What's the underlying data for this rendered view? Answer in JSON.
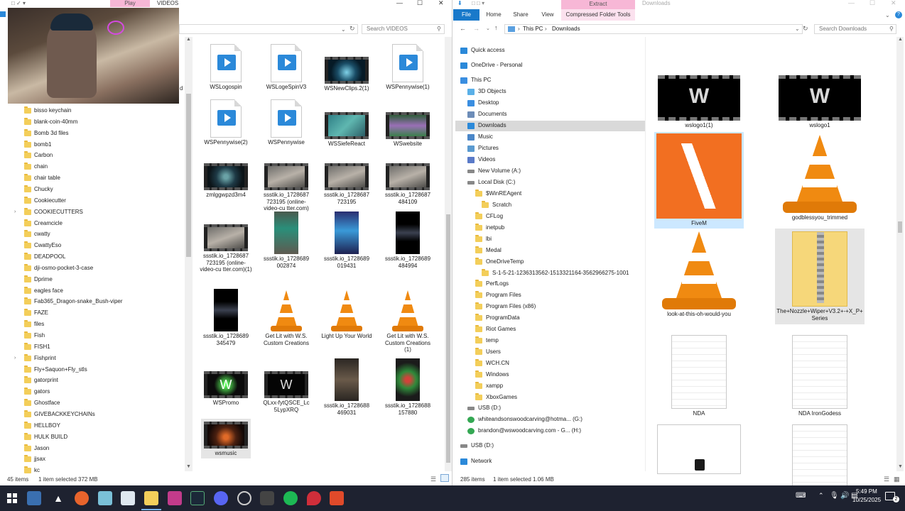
{
  "left_window": {
    "ribbon_tab": "Play",
    "title": "VIDEOS",
    "search_placeholder": "Search VIDEOS",
    "tree": [
      "bisso keychain",
      "blank-coin-40mm",
      "Bomb 3d files",
      "bomb1",
      "Carbon",
      "chain",
      "chair table",
      "Chucky",
      "Cookiecutter",
      "COOKIECUTTERS",
      "Creamcicle",
      "cwatty",
      "CwattyEso",
      "DEADPOOL",
      "dji-osmo-pocket-3-case",
      "Dprime",
      "eagles face",
      "Fab365_Dragon-snake_Bush-viper",
      "FAZE",
      "files",
      "Fish",
      "FISH1",
      "Fishprint",
      "Fly+Saquon+Fly_stls",
      "gatorprint",
      "gators",
      "Ghostface",
      "GIVEBACKKEYCHAINs",
      "HELLBOY",
      "HULK BUILD",
      "Jason",
      "jjsax",
      "kc"
    ],
    "files": [
      {
        "label": "WSLogospin",
        "kind": "video-doc"
      },
      {
        "label": "WSLogeSpinV3",
        "kind": "video-doc"
      },
      {
        "label": "WSNewClips.2(1)",
        "kind": "film-blue"
      },
      {
        "label": "WSPennywise(1)",
        "kind": "video-doc"
      },
      {
        "label": "WSPennywise(2)",
        "kind": "video-doc"
      },
      {
        "label": "WSPennywise",
        "kind": "video-doc"
      },
      {
        "label": "WSSiefeReact",
        "kind": "film-teal"
      },
      {
        "label": "WSwebsite",
        "kind": "film-green"
      },
      {
        "label": "zmlggwpzd3m4",
        "kind": "film-dark"
      },
      {
        "label": "ssstik.io_1728687 723195 (online-video-cu tter.com)",
        "kind": "film-grey"
      },
      {
        "label": "ssstik.io_1728687 723195",
        "kind": "film-grey"
      },
      {
        "label": "ssstik.io_1728687 484109",
        "kind": "film-grey"
      },
      {
        "label": "ssstik.io_1728687 723195 (online-video-cu tter.com)(1)",
        "kind": "film-grey"
      },
      {
        "label": "ssstik.io_1728689 002874",
        "kind": "portrait-green"
      },
      {
        "label": "ssstik.io_1728689 019431",
        "kind": "portrait-blue"
      },
      {
        "label": "ssstik.io_1728689 484994",
        "kind": "portrait-black"
      },
      {
        "label": "ssstik.io_1728689 345479",
        "kind": "portrait-black"
      },
      {
        "label": "Get Lit with W.S. Custom Creations",
        "kind": "cone"
      },
      {
        "label": "Light Up Your World",
        "kind": "cone"
      },
      {
        "label": "Get Lit with W.S. Custom Creations (1)",
        "kind": "cone"
      },
      {
        "label": "WSPromo",
        "kind": "film-logo"
      },
      {
        "label": "QLxx-fytQSCE_Lc 5LypXRQ",
        "kind": "film-logo-black"
      },
      {
        "label": "ssstik.io_1728688 469031",
        "kind": "portrait-brown"
      },
      {
        "label": "ssstik.io_1728688 157880",
        "kind": "portrait-green2"
      },
      {
        "label": "wsmusic",
        "kind": "film-fire"
      }
    ],
    "status_items": "45 items",
    "status_selected": "1 item selected  372 MB"
  },
  "right_window": {
    "ribbon_tab_extract": "Extract",
    "title": "Downloads",
    "tabs": [
      "File",
      "Home",
      "Share",
      "View",
      "Compressed Folder Tools"
    ],
    "breadcrumb": [
      "This PC",
      "Downloads"
    ],
    "search_placeholder": "Search Downloads",
    "nav": [
      {
        "label": "Quick access",
        "indent": 0,
        "icon": "star"
      },
      {
        "label": "OneDrive - Personal",
        "indent": 0,
        "icon": "cloud"
      },
      {
        "label": "This PC",
        "indent": 0,
        "icon": "pc"
      },
      {
        "label": "3D Objects",
        "indent": 1,
        "icon": "obj3d"
      },
      {
        "label": "Desktop",
        "indent": 1,
        "icon": "desktop"
      },
      {
        "label": "Documents",
        "indent": 1,
        "icon": "docs"
      },
      {
        "label": "Downloads",
        "indent": 1,
        "icon": "download",
        "selected": true
      },
      {
        "label": "Music",
        "indent": 1,
        "icon": "music"
      },
      {
        "label": "Pictures",
        "indent": 1,
        "icon": "pictures"
      },
      {
        "label": "Videos",
        "indent": 1,
        "icon": "videos"
      },
      {
        "label": "New Volume (A:)",
        "indent": 1,
        "icon": "drive"
      },
      {
        "label": "Local Disk (C:)",
        "indent": 1,
        "icon": "drive"
      },
      {
        "label": "$WinREAgent",
        "indent": 2,
        "icon": "folder"
      },
      {
        "label": "Scratch",
        "indent": 3,
        "icon": "folder"
      },
      {
        "label": "CFLog",
        "indent": 2,
        "icon": "folder"
      },
      {
        "label": "inetpub",
        "indent": 2,
        "icon": "folder"
      },
      {
        "label": "lbi",
        "indent": 2,
        "icon": "folder"
      },
      {
        "label": "Medal",
        "indent": 2,
        "icon": "folder"
      },
      {
        "label": "OneDriveTemp",
        "indent": 2,
        "icon": "folder"
      },
      {
        "label": "S-1-5-21-1236313562-1513321164-3562966275-1001",
        "indent": 3,
        "icon": "folder"
      },
      {
        "label": "PerfLogs",
        "indent": 2,
        "icon": "folder"
      },
      {
        "label": "Program Files",
        "indent": 2,
        "icon": "folder"
      },
      {
        "label": "Program Files (x86)",
        "indent": 2,
        "icon": "folder"
      },
      {
        "label": "ProgramData",
        "indent": 2,
        "icon": "folder"
      },
      {
        "label": "Riot Games",
        "indent": 2,
        "icon": "folder"
      },
      {
        "label": "temp",
        "indent": 2,
        "icon": "folder"
      },
      {
        "label": "Users",
        "indent": 2,
        "icon": "folder"
      },
      {
        "label": "WCH.CN",
        "indent": 2,
        "icon": "folder"
      },
      {
        "label": "Windows",
        "indent": 2,
        "icon": "folder"
      },
      {
        "label": "xampp",
        "indent": 2,
        "icon": "folder"
      },
      {
        "label": "XboxGames",
        "indent": 2,
        "icon": "folder"
      },
      {
        "label": "USB (D:)",
        "indent": 1,
        "icon": "drive"
      },
      {
        "label": "whiteandsonswoodcarving@hotma... (G:)",
        "indent": 1,
        "icon": "gdrive"
      },
      {
        "label": "brandon@wswoodcarving.com - G... (H:)",
        "indent": 1,
        "icon": "gdrive"
      },
      {
        "label": "USB (D:)",
        "indent": 0,
        "icon": "drive"
      },
      {
        "label": "Network",
        "indent": 0,
        "icon": "network"
      }
    ],
    "files": [
      {
        "label": "wslogo1(1)",
        "kind": "logo-film"
      },
      {
        "label": "wslogo1",
        "kind": "logo-film"
      },
      {
        "label": "FiveM",
        "kind": "fivem"
      },
      {
        "label": "godblessyou_trimmed",
        "kind": "cone"
      },
      {
        "label": "look-at-this-oh-would-you",
        "kind": "cone"
      },
      {
        "label": "The+Nozzle+Wiper+V3.2+-+X_P+ Series",
        "kind": "zip"
      },
      {
        "label": "NDA",
        "kind": "doc"
      },
      {
        "label": "NDA IronGodess",
        "kind": "doc"
      },
      {
        "label": "",
        "kind": "doc-icon"
      },
      {
        "label": "",
        "kind": "doc"
      }
    ],
    "status_items": "285 items",
    "status_selected": "1 item selected  1.06 MB"
  },
  "taskbar": {
    "time": "5:49 PM",
    "date": "10/25/2025",
    "notification_count": "2"
  },
  "colors": {
    "accent": "#0063b1",
    "selection": "#cce8ff",
    "folder": "#f3ce5a",
    "vlc": "#f08a11",
    "fivem": "#f26f21",
    "taskbar": "#1e2230"
  }
}
